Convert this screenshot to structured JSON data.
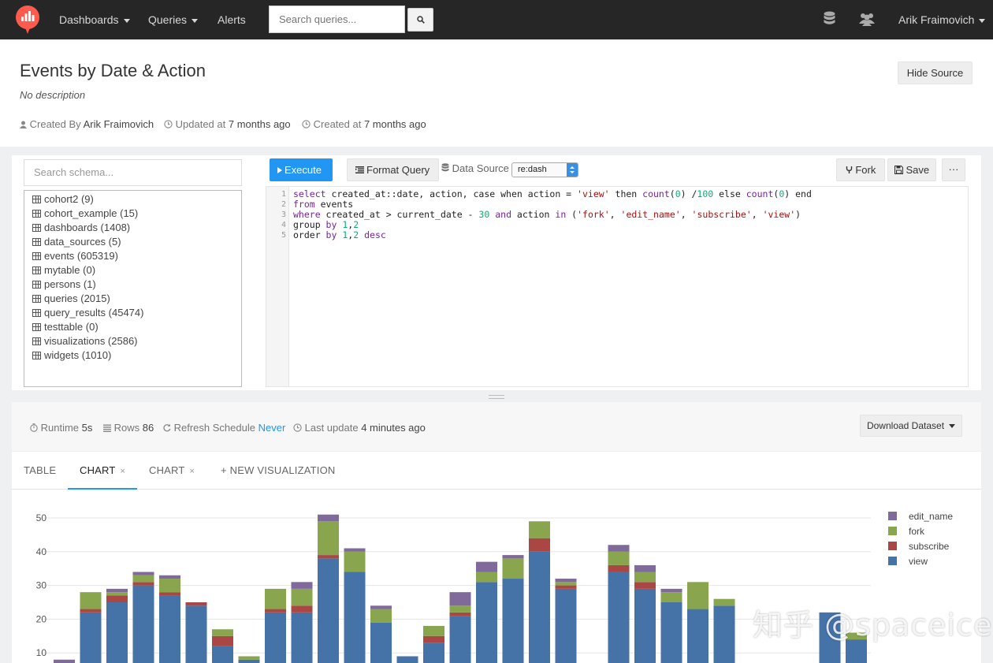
{
  "nav": {
    "dashboards": "Dashboards",
    "queries": "Queries",
    "alerts": "Alerts",
    "search_placeholder": "Search queries...",
    "user": "Arik Fraimovich",
    "icons": [
      "logo-icon",
      "search-icon",
      "database-icon",
      "users-icon"
    ]
  },
  "query": {
    "title": "Events by Date & Action",
    "description": "No description",
    "created_by_label": "Created By",
    "created_by": "Arik Fraimovich",
    "updated_label": "Updated at",
    "updated": "7 months ago",
    "created_label": "Created at",
    "created": "7 months ago",
    "hide_source": "Hide Source"
  },
  "schema": {
    "search_placeholder": "Search schema...",
    "tables": [
      "cohort2 (9)",
      "cohort_example (15)",
      "dashboards (1408)",
      "data_sources (5)",
      "events (605319)",
      "mytable (0)",
      "persons (1)",
      "queries (2015)",
      "query_results (45474)",
      "testtable (0)",
      "visualizations (2586)",
      "widgets (1010)"
    ]
  },
  "editor": {
    "execute": "Execute",
    "format": "Format Query",
    "data_source_label": "Data Source",
    "data_source": "re:dash",
    "fork": "Fork",
    "save": "Save",
    "more": "···",
    "line_numbers": [
      "1",
      "2",
      "3",
      "4",
      "5"
    ],
    "code": [
      "select created_at::date, action, case when action = 'view' then count(0) /100 else count(0) end",
      "from events",
      "where created_at > current_date - 30 and action in ('fork', 'edit_name', 'subscribe', 'view')",
      "group by 1,2",
      "order by 1,2 desc"
    ]
  },
  "results": {
    "runtime_label": "Runtime",
    "runtime": "5s",
    "rows_label": "Rows",
    "rows": "86",
    "refresh_label": "Refresh Schedule",
    "refresh": "Never",
    "last_update_label": "Last update",
    "last_update": "4 minutes ago",
    "download": "Download Dataset"
  },
  "tabs": [
    {
      "label": "TABLE",
      "closable": false,
      "active": false
    },
    {
      "label": "CHART",
      "closable": true,
      "active": true
    },
    {
      "label": "CHART",
      "closable": true,
      "active": false
    },
    {
      "label": "+ NEW VISUALIZATION",
      "closable": false,
      "active": false
    }
  ],
  "tab_close": "×",
  "chart_data": {
    "type": "bar",
    "stacked": true,
    "y_ticks": [
      "50",
      "40",
      "30",
      "20",
      "10"
    ],
    "ylim": [
      0,
      54
    ],
    "grid": true,
    "legend_position": "top-right",
    "series": [
      {
        "name": "view",
        "color": "#4572a7",
        "values": [
          7,
          22,
          25,
          30,
          27,
          24,
          12,
          8,
          22,
          22,
          38,
          34,
          19,
          9,
          13,
          21,
          31,
          32,
          40,
          29,
          null,
          34,
          29,
          25,
          23,
          24,
          null,
          null,
          null,
          22,
          14
        ]
      },
      {
        "name": "subscribe",
        "color": "#aa4643",
        "values": [
          0,
          1,
          2,
          1,
          1,
          1,
          3,
          0,
          1,
          2,
          1,
          0,
          0,
          0,
          2,
          1,
          0,
          0,
          4,
          1,
          null,
          2,
          2,
          0,
          0,
          0,
          null,
          null,
          null,
          0,
          0
        ]
      },
      {
        "name": "fork",
        "color": "#89a54e",
        "values": [
          0,
          5,
          1,
          2,
          4,
          0,
          2,
          1,
          6,
          5,
          10,
          6,
          4,
          0,
          3,
          2,
          3,
          6,
          5,
          1,
          1,
          4,
          3,
          3,
          8,
          2,
          null,
          null,
          1,
          0,
          2
        ]
      },
      {
        "name": "edit_name",
        "color": "#80699b",
        "values": [
          1,
          0,
          1,
          1,
          1,
          0,
          0,
          0,
          0,
          2,
          2,
          1,
          1,
          0,
          0,
          4,
          3,
          1,
          0,
          1,
          0,
          2,
          2,
          1,
          0,
          0,
          null,
          null,
          0,
          0,
          0
        ]
      }
    ]
  },
  "watermark": "知乎 @spaceice"
}
